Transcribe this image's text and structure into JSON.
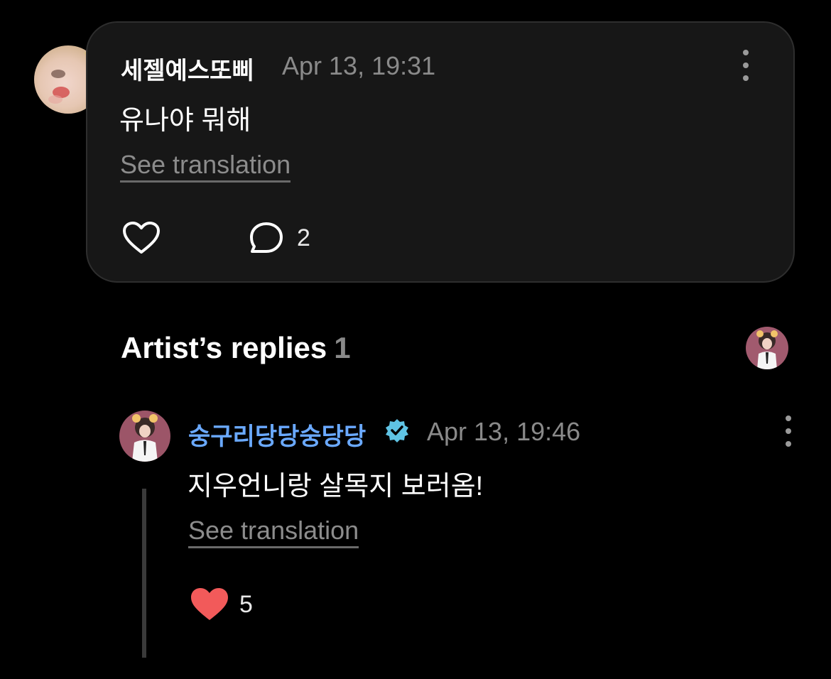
{
  "comment": {
    "author": "세젤예스또삐",
    "timestamp": "Apr 13, 19:31",
    "text": "유나야 뭐해",
    "see_translation": "See translation",
    "reply_count": "2"
  },
  "artist_replies": {
    "title": "Artist’s replies",
    "count": "1"
  },
  "reply": {
    "author": "숭구리당당숭당당",
    "author_color": "#6aa9ff",
    "verified_color": "#5fc3e4",
    "timestamp": "Apr 13, 19:46",
    "text": "지우언니랑 살목지 보러옴!",
    "see_translation": "See translation",
    "like_count": "5",
    "like_color": "#f25a5a"
  },
  "icons": {
    "more": "more-vertical-icon",
    "like": "heart-outline-icon",
    "reply": "speech-bubble-icon",
    "liked": "heart-filled-icon",
    "verified": "verified-badge-icon"
  }
}
